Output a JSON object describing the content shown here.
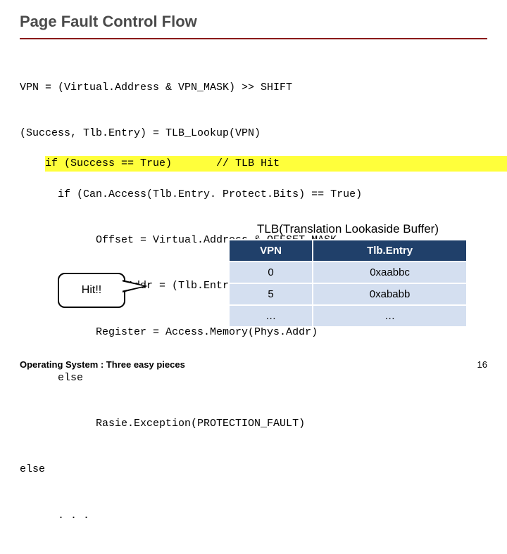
{
  "title": "Page Fault Control Flow",
  "code": {
    "l1": "VPN = (Virtual.Address & VPN_MASK) >> SHIFT",
    "l2": "(Success, Tlb.Entry) = TLB_Lookup(VPN)",
    "l3": "if (Success == True)       // TLB Hit",
    "l4": "      if (Can.Access(Tlb.Entry. Protect.Bits) == True)",
    "l5": "            Offset = Virtual.Address & OFFSET_MASK",
    "l6": "            Phys.Addr = (Tlb.Entry. PFN << SHIFT) | Offset",
    "l7": "            Register = Access.Memory(Phys.Addr)",
    "l8": "      else",
    "l9": "            Rasie.Exception(PROTECTION_FAULT)",
    "l10": "else",
    "l11": "      . . ."
  },
  "callout": "Hit!!",
  "table": {
    "caption": "TLB(Translation Lookaside Buffer)",
    "headers": {
      "c1": "VPN",
      "c2": "Tlb.Entry"
    },
    "rows": [
      {
        "c1": "0",
        "c2": "0xaabbc"
      },
      {
        "c1": "5",
        "c2": "0xababb"
      },
      {
        "c1": "…",
        "c2": "…"
      }
    ]
  },
  "footer": "Operating System : Three easy pieces",
  "page_number": "16"
}
